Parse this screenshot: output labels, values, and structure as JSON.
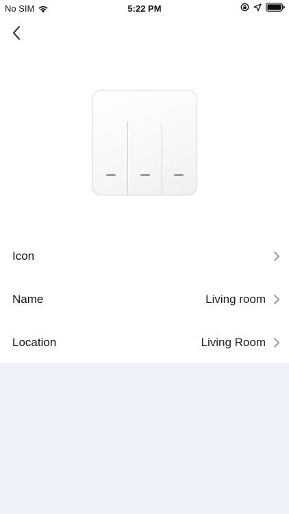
{
  "status_bar": {
    "carrier": "No SIM",
    "time": "5:22 PM",
    "icons": [
      "wifi-icon",
      "orientation-lock-icon",
      "location-icon",
      "battery-icon"
    ]
  },
  "nav": {
    "back_icon": "chevron-left-icon"
  },
  "device": {
    "image": "three-gang-switch",
    "gang_count": 3
  },
  "settings": {
    "items": [
      {
        "label": "Icon",
        "value": ""
      },
      {
        "label": "Name",
        "value": "Living room"
      },
      {
        "label": "Location",
        "value": "Living Room"
      }
    ]
  },
  "colors": {
    "background": "#ffffff",
    "bottom_area": "#eff1fa",
    "chevron": "#8a8a8a",
    "text": "#111111"
  }
}
